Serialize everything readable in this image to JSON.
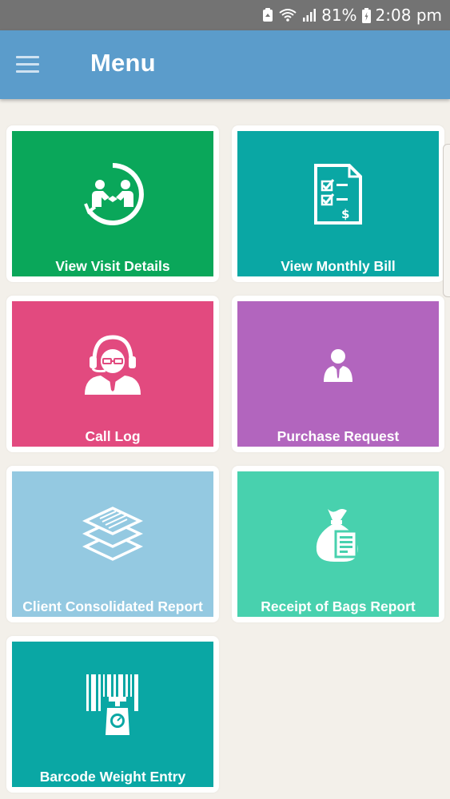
{
  "status_bar": {
    "battery": "81%",
    "time": "2:08 pm"
  },
  "header": {
    "title": "Menu"
  },
  "colors": {
    "app_bar": "#5b9ccb",
    "status_bar": "#737373",
    "background": "#f3f0ea"
  },
  "tiles": [
    {
      "label": "View Visit Details",
      "icon": "handshake-icon",
      "color": "#0aa75a"
    },
    {
      "label": "View Monthly Bill",
      "icon": "bill-checklist-icon",
      "color": "#0aa7a4"
    },
    {
      "label": "Call Log",
      "icon": "support-agent-icon",
      "color": "#e24a7f"
    },
    {
      "label": "Purchase Request",
      "icon": "person-icon",
      "color": "#b265be"
    },
    {
      "label": "Client Consolidated Report",
      "icon": "layers-icon",
      "color": "#94c9e1"
    },
    {
      "label": "Receipt of Bags Report",
      "icon": "money-bag-icon",
      "color": "#48d1ae"
    },
    {
      "label": "Barcode Weight Entry",
      "icon": "barcode-scale-icon",
      "color": "#0aa7a4"
    }
  ]
}
